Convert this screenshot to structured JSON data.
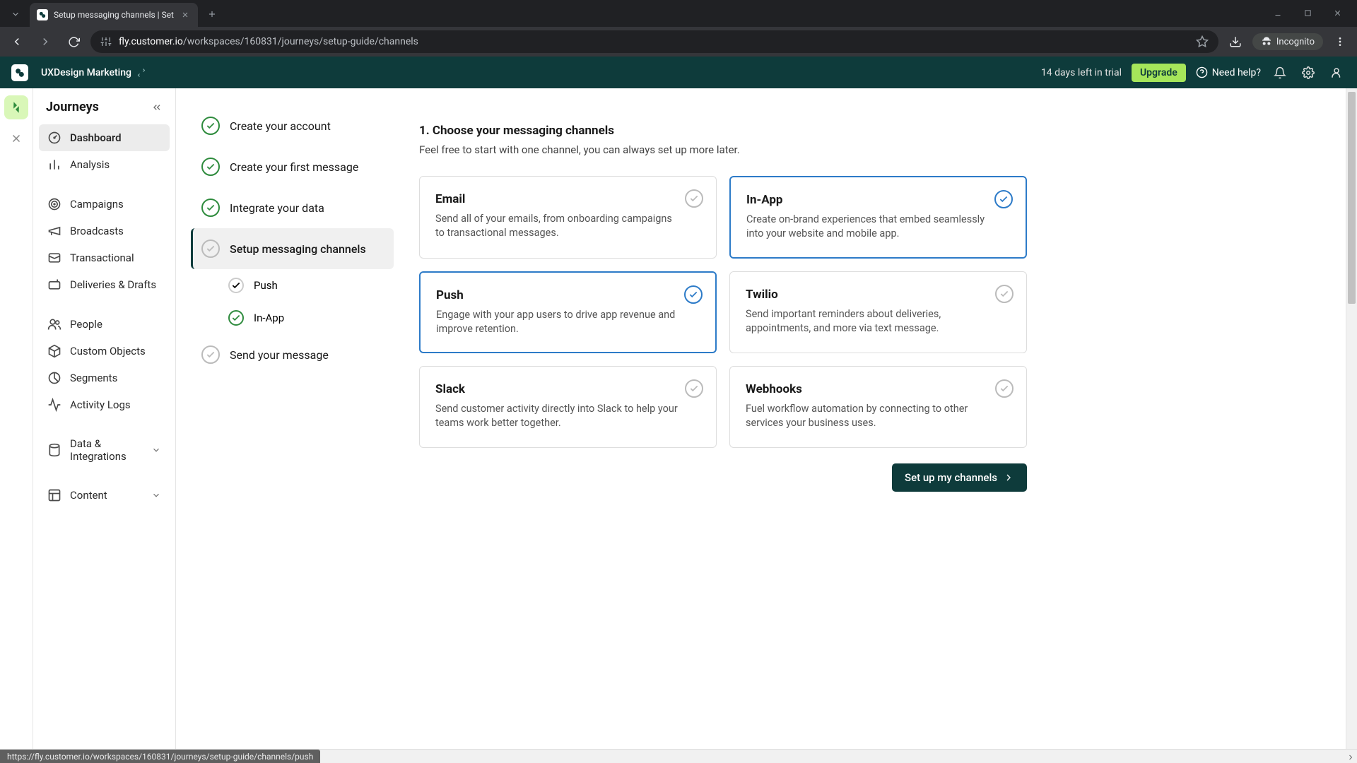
{
  "browser": {
    "tab_title": "Setup messaging channels | Set",
    "url_host": "fly.customer.io",
    "url_path": "/workspaces/160831/journeys/setup-guide/channels",
    "incognito_label": "Incognito"
  },
  "header": {
    "workspace": "UXDesign Marketing",
    "trial_text": "14 days left in trial",
    "upgrade_label": "Upgrade",
    "help_label": "Need help?"
  },
  "sidebar": {
    "title": "Journeys",
    "items": [
      {
        "label": "Dashboard",
        "icon": "gauge",
        "active": true
      },
      {
        "label": "Analysis",
        "icon": "chart"
      },
      {
        "label": "Campaigns",
        "icon": "target"
      },
      {
        "label": "Broadcasts",
        "icon": "megaphone"
      },
      {
        "label": "Transactional",
        "icon": "transaction"
      },
      {
        "label": "Deliveries & Drafts",
        "icon": "mailbox"
      },
      {
        "label": "People",
        "icon": "people"
      },
      {
        "label": "Custom Objects",
        "icon": "cube"
      },
      {
        "label": "Segments",
        "icon": "segments"
      },
      {
        "label": "Activity Logs",
        "icon": "activity"
      },
      {
        "label": "Data & Integrations",
        "icon": "data",
        "expandable": true
      },
      {
        "label": "Content",
        "icon": "content",
        "expandable": true
      }
    ]
  },
  "steps": {
    "items": [
      {
        "label": "Create your account",
        "done": true
      },
      {
        "label": "Create your first message",
        "done": true
      },
      {
        "label": "Integrate your data",
        "done": true
      },
      {
        "label": "Setup messaging channels",
        "done": false,
        "active": true
      },
      {
        "label": "Send your message",
        "done": false
      }
    ],
    "substeps": [
      {
        "label": "Push",
        "done": false
      },
      {
        "label": "In-App",
        "done": true
      }
    ]
  },
  "main": {
    "section_title": "1. Choose your messaging channels",
    "section_sub": "Feel free to start with one channel, you can always set up more later.",
    "channels": [
      {
        "key": "email",
        "title": "Email",
        "desc": "Send all of your emails, from onboarding campaigns to transactional messages.",
        "selected": false
      },
      {
        "key": "inapp",
        "title": "In-App",
        "desc": "Create on-brand experiences that embed seamlessly into your website and mobile app.",
        "selected": true
      },
      {
        "key": "push",
        "title": "Push",
        "desc": "Engage with your app users to drive app revenue and improve retention.",
        "selected": true
      },
      {
        "key": "twilio",
        "title": "Twilio",
        "desc": "Send important reminders about deliveries, appointments, and more via text message.",
        "selected": false
      },
      {
        "key": "slack",
        "title": "Slack",
        "desc": "Send customer activity directly into Slack to help your teams work better together.",
        "selected": false
      },
      {
        "key": "webhooks",
        "title": "Webhooks",
        "desc": "Fuel workflow automation by connecting to other services your business uses.",
        "selected": false
      }
    ],
    "cta_label": "Set up my channels"
  },
  "status": {
    "url": "https://fly.customer.io/workspaces/160831/journeys/setup-guide/channels/push"
  }
}
